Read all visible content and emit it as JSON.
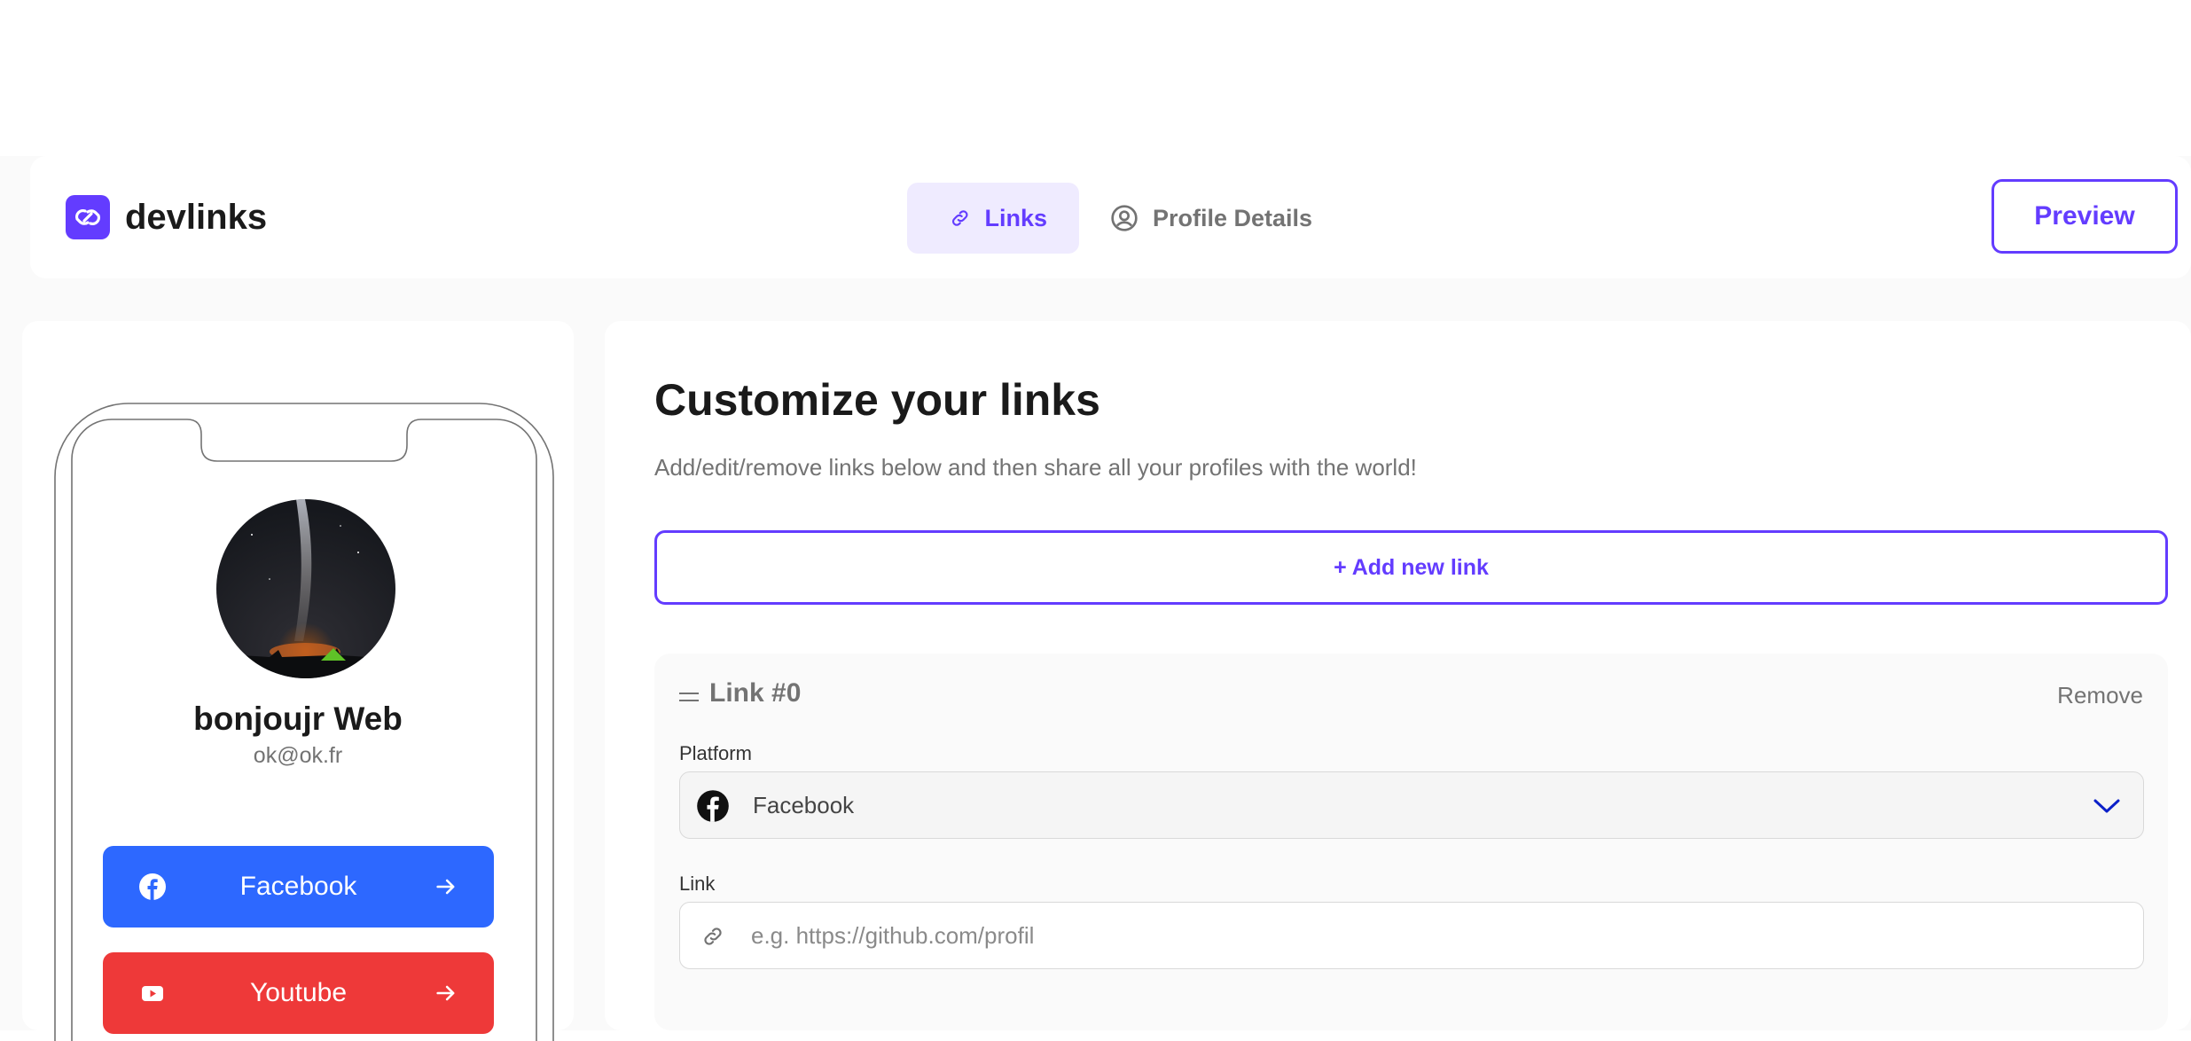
{
  "app": {
    "name": "devlinks",
    "accent_color": "#633cff"
  },
  "nav": {
    "tabs": [
      {
        "label": "Links",
        "icon": "link-icon",
        "active": true
      },
      {
        "label": "Profile Details",
        "icon": "user-circle-icon",
        "active": false
      }
    ],
    "preview_label": "Preview"
  },
  "preview": {
    "name": "bonjoujr Web",
    "email": "ok@ok.fr",
    "avatar": "night-sky-photo",
    "links": [
      {
        "platform": "Facebook",
        "icon": "facebook-icon",
        "color": "#2d68ff"
      },
      {
        "platform": "Youtube",
        "icon": "youtube-icon",
        "color": "#ee3939"
      }
    ]
  },
  "editor": {
    "title": "Customize your links",
    "subtitle": "Add/edit/remove links below and then share all your profiles with the world!",
    "add_link_label": "+ Add new link",
    "links": [
      {
        "title": "Link #0",
        "remove_label": "Remove",
        "platform_label": "Platform",
        "platform_value": "Facebook",
        "platform_icon": "facebook-icon",
        "link_label": "Link",
        "link_value": "",
        "link_placeholder": "e.g. https://github.com/profil"
      }
    ]
  }
}
